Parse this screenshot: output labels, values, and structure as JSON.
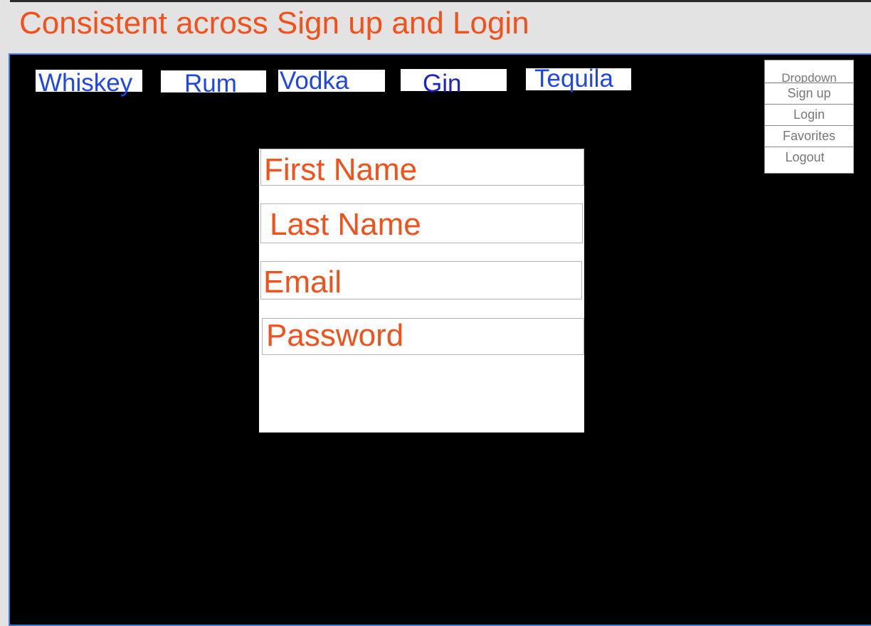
{
  "page": {
    "title": "Consistent across Sign up and Login"
  },
  "nav": {
    "tabs": [
      {
        "label": "Whiskey"
      },
      {
        "label": "Rum"
      },
      {
        "label": "Vodka"
      },
      {
        "label": "Gin"
      },
      {
        "label": "Tequila"
      }
    ]
  },
  "dropdown": {
    "header": "Dropdown",
    "items": [
      {
        "label": "Sign up"
      },
      {
        "label": "Login"
      },
      {
        "label": "Favorites"
      },
      {
        "label": "Logout"
      }
    ]
  },
  "form": {
    "fields": [
      {
        "placeholder": "First Name"
      },
      {
        "placeholder": "Last Name"
      },
      {
        "placeholder": "Email"
      },
      {
        "placeholder": "Password"
      }
    ]
  },
  "colors": {
    "title": "#f2511b",
    "nav_text": "#1f46e8",
    "field_text": "#f2511b",
    "canvas_background": "#000000",
    "canvas_border": "#3d7be0"
  }
}
